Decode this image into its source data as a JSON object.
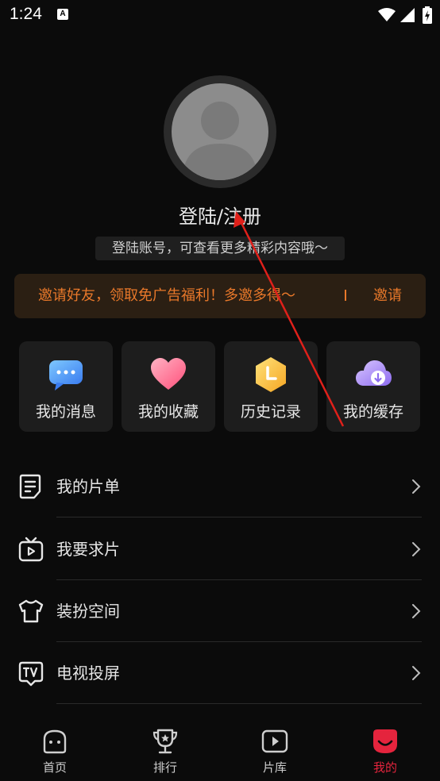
{
  "status_bar": {
    "time": "1:24",
    "notification_icon": "A"
  },
  "profile": {
    "login_title": "登陆/注册",
    "login_subtitle": "登陆账号，可查看更多精彩内容哦～"
  },
  "invite_banner": {
    "text": "邀请好友，领取免广告福利！多邀多得～",
    "button": "邀请"
  },
  "quick_tiles": [
    {
      "label": "我的消息",
      "icon": "message-icon"
    },
    {
      "label": "我的收藏",
      "icon": "heart-icon"
    },
    {
      "label": "历史记录",
      "icon": "history-icon"
    },
    {
      "label": "我的缓存",
      "icon": "cloud-download-icon"
    }
  ],
  "menu": [
    {
      "label": "我的片单",
      "icon": "list-doc-icon"
    },
    {
      "label": "我要求片",
      "icon": "tv-request-icon"
    },
    {
      "label": "装扮空间",
      "icon": "shirt-icon"
    },
    {
      "label": "电视投屏",
      "icon": "tv-cast-icon"
    }
  ],
  "tabs": [
    {
      "label": "首页",
      "icon": "home-icon"
    },
    {
      "label": "排行",
      "icon": "trophy-icon"
    },
    {
      "label": "片库",
      "icon": "play-library-icon"
    },
    {
      "label": "我的",
      "icon": "mine-icon"
    }
  ],
  "colors": {
    "accent": "#e5243d",
    "invite_text": "#e8782a",
    "invite_bg": "#2b1f13"
  }
}
